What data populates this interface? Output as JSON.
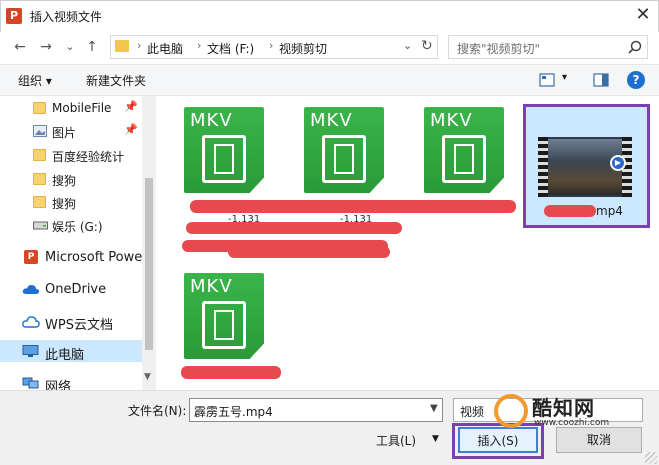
{
  "window": {
    "title": "插入视频文件",
    "app_icon": "P",
    "close": "✕"
  },
  "nav": {
    "back": "←",
    "forward": "→",
    "dropdown": "⌄",
    "up": "↑",
    "breadcrumb": [
      "此电脑",
      "文档 (F:)",
      "视频剪切"
    ],
    "separator": "›",
    "refresh": "↻",
    "search_placeholder": "搜索\"视频剪切\""
  },
  "toolbar": {
    "organize": "组织 ▾",
    "new_folder": "新建文件夹",
    "view_dd": "▾",
    "help": "?"
  },
  "sidebar": {
    "items": [
      {
        "label": "MobileFile",
        "pinned": true
      },
      {
        "label": "图片",
        "pinned": true
      },
      {
        "label": "百度经验统计"
      },
      {
        "label": "搜狗"
      },
      {
        "label": "搜狗"
      },
      {
        "label": "娱乐 (G:)"
      },
      {
        "label": "Microsoft Power"
      },
      {
        "label": "OneDrive"
      },
      {
        "label": "WPS云文档"
      },
      {
        "label": "此电脑",
        "selected": true
      },
      {
        "label": "网络"
      }
    ],
    "pin_icon": "📌"
  },
  "files": {
    "mkv_badge": "MKV",
    "partial_labels": [
      "-1.131",
      "-1.131"
    ],
    "selected_file_suffix": "mp4"
  },
  "bottom": {
    "filename_label": "文件名(N):",
    "filename_value": "霹雳五号.mp4",
    "type_value": "视频",
    "tools": "工具(L)",
    "insert": "插入(S)",
    "cancel": "取消"
  },
  "watermark": {
    "title": "酷知网",
    "url": "www.coozhi.com"
  },
  "colors": {
    "accent": "#7b3fb0",
    "redaction": "#e8494f",
    "mkv_green": "#3ab54a",
    "selection": "#cce8ff"
  }
}
